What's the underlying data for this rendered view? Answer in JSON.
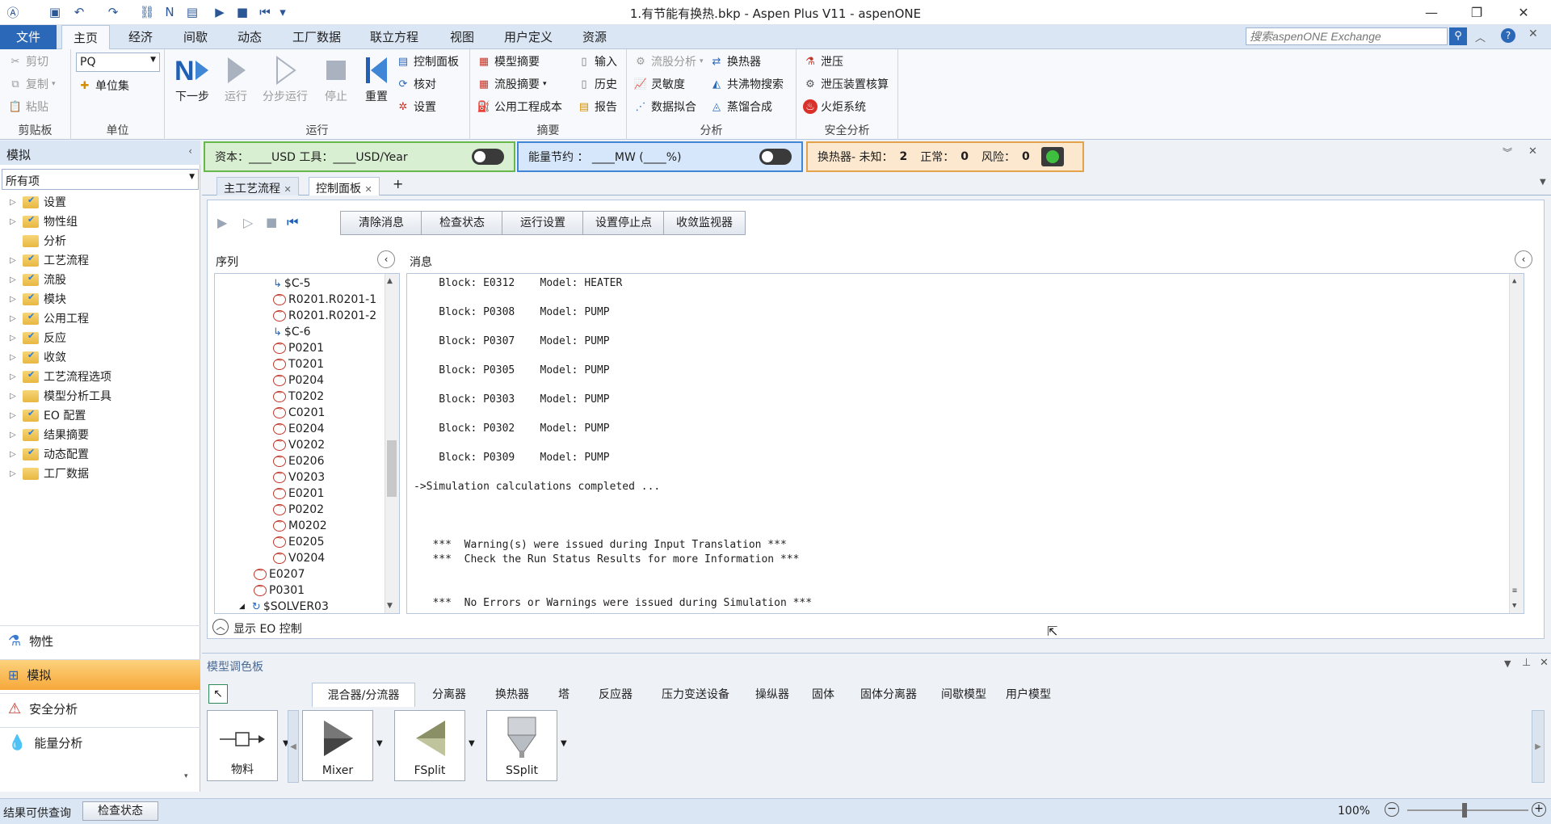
{
  "window": {
    "title": "1.有节能有换热.bkp - Aspen Plus V11 - aspenONE"
  },
  "ribbon_tabs": [
    "文件",
    "主页",
    "经济",
    "间歇",
    "动态",
    "工厂数据",
    "联立方程",
    "视图",
    "用户定义",
    "资源"
  ],
  "search": {
    "placeholder": "搜索aspenONE Exchange"
  },
  "clipboard": {
    "cut": "剪切",
    "copy": "复制",
    "paste": "粘贴",
    "label": "剪贴板"
  },
  "units": {
    "set_value": "PQ",
    "unitsets": "单位集",
    "label": "单位"
  },
  "run": {
    "next": "下一步",
    "run": "运行",
    "step": "分步运行",
    "stop": "停止",
    "reset": "重置",
    "control_panel": "控制面板",
    "reconcile": "核对",
    "settings": "设置",
    "label": "运行"
  },
  "summary": {
    "model": "模型摘要",
    "stream": "流股摘要",
    "utility": "公用工程成本",
    "input": "输入",
    "history": "历史",
    "report": "报告",
    "label": "摘要"
  },
  "analysis": {
    "stream": "流股分析",
    "sensitivity": "灵敏度",
    "fit": "数据拟合",
    "hx": "换热器",
    "azeo": "共沸物搜索",
    "distil": "蒸馏合成",
    "label": "分析"
  },
  "safety": {
    "relief": "泄压",
    "relief_rating": "泄压装置核算",
    "flare": "火炬系统",
    "label": "安全分析"
  },
  "left_panel": {
    "title": "模拟",
    "filter": "所有项",
    "tree": [
      "设置",
      "物性组",
      "分析",
      "工艺流程",
      "流股",
      "模块",
      "公用工程",
      "反应",
      "收敛",
      "工艺流程选项",
      "模型分析工具",
      "EO 配置",
      "结果摘要",
      "动态配置",
      "工厂数据"
    ],
    "nav": [
      "物性",
      "模拟",
      "安全分析",
      "能量分析"
    ]
  },
  "econ_bar": {
    "text": "资本：____USD   工具：____USD/Year"
  },
  "energy_bar": {
    "text": "能量节约 ：  ____MW    (____%)"
  },
  "hx_bar": {
    "prefix": "换热器-  未知：",
    "unknown": "2",
    "normal_label": "正常：",
    "normal": "0",
    "risk_label": "风险：",
    "risk": "0"
  },
  "doc_tabs": [
    "主工艺流程",
    "控制面板"
  ],
  "control_panel": {
    "buttons": [
      "清除消息",
      "检查状态",
      "运行设置",
      "设置停止点",
      "收敛监视器"
    ],
    "seq_label": "序列",
    "msg_label": "消息",
    "sequence": [
      {
        "name": "$C-5",
        "lvl": 2,
        "type": "conv"
      },
      {
        "name": "R0201.R0201-1",
        "lvl": 2,
        "type": "block"
      },
      {
        "name": "R0201.R0201-2",
        "lvl": 2,
        "type": "block"
      },
      {
        "name": "$C-6",
        "lvl": 2,
        "type": "conv"
      },
      {
        "name": "P0201",
        "lvl": 2,
        "type": "block"
      },
      {
        "name": "T0201",
        "lvl": 2,
        "type": "block"
      },
      {
        "name": "P0204",
        "lvl": 2,
        "type": "block"
      },
      {
        "name": "T0202",
        "lvl": 2,
        "type": "block"
      },
      {
        "name": "C0201",
        "lvl": 2,
        "type": "block"
      },
      {
        "name": "E0204",
        "lvl": 2,
        "type": "block"
      },
      {
        "name": "V0202",
        "lvl": 2,
        "type": "block"
      },
      {
        "name": "E0206",
        "lvl": 2,
        "type": "block"
      },
      {
        "name": "V0203",
        "lvl": 2,
        "type": "block"
      },
      {
        "name": "E0201",
        "lvl": 2,
        "type": "block"
      },
      {
        "name": "P0202",
        "lvl": 2,
        "type": "block"
      },
      {
        "name": "M0202",
        "lvl": 2,
        "type": "block"
      },
      {
        "name": "E0205",
        "lvl": 2,
        "type": "block"
      },
      {
        "name": "V0204",
        "lvl": 2,
        "type": "block"
      },
      {
        "name": "E0207",
        "lvl": 1,
        "type": "block"
      },
      {
        "name": "P0301",
        "lvl": 1,
        "type": "block"
      },
      {
        "name": "$SOLVER03",
        "lvl": 1,
        "type": "solver"
      }
    ],
    "messages": [
      "    Block: E0312    Model: HEATER",
      "    Block: P0308    Model: PUMP",
      "    Block: P0307    Model: PUMP",
      "    Block: P0305    Model: PUMP",
      "    Block: P0303    Model: PUMP",
      "    Block: P0302    Model: PUMP",
      "    Block: P0309    Model: PUMP",
      "->Simulation calculations completed ...",
      "   ***  Warning(s) were issued during Input Translation ***",
      "   ***  Check the Run Status Results for more Information ***",
      "   ***  No Errors or Warnings were issued during Simulation ***"
    ],
    "eo_toggle": "显示 EO 控制"
  },
  "palette": {
    "title": "模型调色板",
    "tabs": [
      "混合器/分流器",
      "分离器",
      "换热器",
      "塔",
      "反应器",
      "压力变送设备",
      "操纵器",
      "固体",
      "固体分离器",
      "间歇模型",
      "用户模型"
    ],
    "items": [
      "物料",
      "Mixer",
      "FSplit",
      "SSplit"
    ]
  },
  "status": {
    "text": "结果可供查询",
    "check": "检查状态",
    "zoom": "100%"
  }
}
